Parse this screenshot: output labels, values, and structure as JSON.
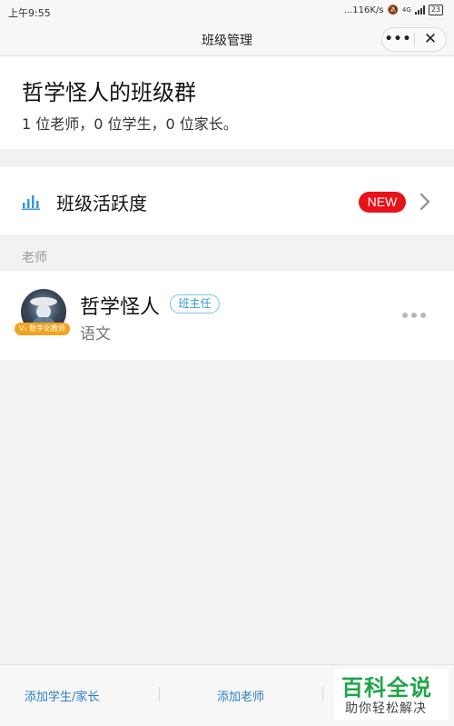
{
  "statusbar": {
    "time": "上午9:55",
    "network_speed": "...116K/s",
    "signal_label": "4G",
    "battery": "23"
  },
  "navbar": {
    "title": "班级管理",
    "more_label": "•••",
    "close_label": "✕"
  },
  "group": {
    "name": "哲学怪人的班级群",
    "summary": "1 位老师，0 位学生，0 位家长。"
  },
  "activity": {
    "label": "班级活跃度",
    "badge": "NEW",
    "icon": "bar-chart-icon"
  },
  "teachers_section": {
    "label": "老师",
    "items": [
      {
        "name": "哲学怪人",
        "role": "班主任",
        "subject": "语文",
        "avatar_badge": "V₁ 数字化教师"
      }
    ]
  },
  "bottom_bar": {
    "add_student_parent": "添加学生/家长",
    "add_teacher": "添加老师"
  },
  "watermark": {
    "title": "百科全说",
    "subtitle": "助你轻松解决"
  },
  "colors": {
    "accent_blue": "#2a7fc2",
    "badge_red": "#e9121a",
    "role_blue": "#2e9ccd",
    "verified_orange": "#f3a21b",
    "watermark_green": "#20a54a"
  }
}
